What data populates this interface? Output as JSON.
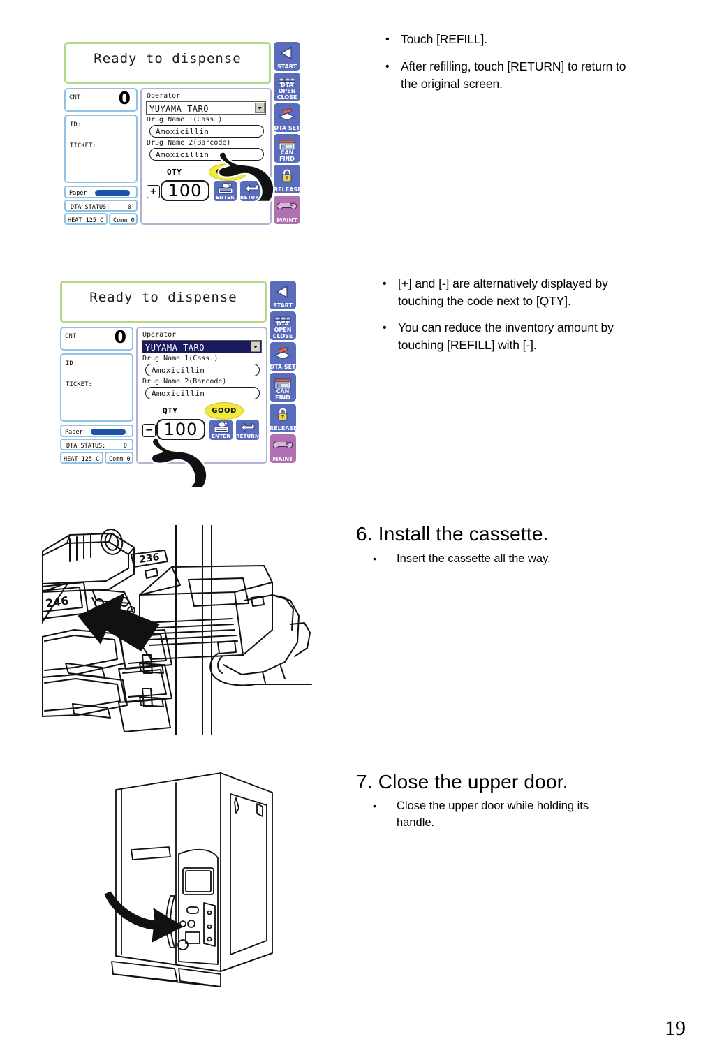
{
  "page": {
    "number": "19"
  },
  "screens": [
    {
      "id": "screen-refill-plus",
      "message": "Ready to dispense",
      "status": {
        "cnt_label": "CNT",
        "cnt_value": "0",
        "id_label": "ID:",
        "ticket_label": "TICKET:",
        "paper_label": "Paper",
        "dta_status_label": "DTA STATUS:",
        "dta_status_value": "0",
        "heat_label": "HEAT 125  C",
        "comm_label": "Comm 0"
      },
      "form": {
        "operator_label": "Operator",
        "operator_value": "YUYAMA TARO",
        "operator_selected": false,
        "drug1_label": "Drug Name 1(Cass.)",
        "drug1_value": "Amoxicillin",
        "drug2_label": "Drug Name 2(Barcode)",
        "drug2_value": "Amoxicillin",
        "qty_label": "QTY",
        "qty_value": "100",
        "sign_button": "+",
        "good_badge": "GOOD",
        "enter_label": "ENTER",
        "return_label": "RETURN"
      },
      "sidebar": [
        {
          "label": "START",
          "icon": "left-triangle-icon",
          "color": "#5a6dbd"
        },
        {
          "label": "DTA OPEN CLOSE",
          "icon": "dta-open-close-icon",
          "color": "#5a6dbd"
        },
        {
          "label": "DTA SET",
          "icon": "dta-set-icon",
          "color": "#5a6dbd"
        },
        {
          "label": "CAN FIND",
          "icon": "can-find-icon",
          "color": "#5a6dbd"
        },
        {
          "label": "RELEASE",
          "icon": "lock-icon",
          "color": "#5a6dbd"
        },
        {
          "label": "MAINT",
          "icon": "wrench-icon",
          "color": "#b071b3"
        }
      ]
    },
    {
      "id": "screen-refill-minus",
      "message": "Ready to dispense",
      "status": {
        "cnt_label": "CNT",
        "cnt_value": "0",
        "id_label": "ID:",
        "ticket_label": "TICKET:",
        "paper_label": "Paper",
        "dta_status_label": "DTA STATUS:",
        "dta_status_value": "0",
        "heat_label": "HEAT 125  C",
        "comm_label": "Comm 0"
      },
      "form": {
        "operator_label": "Operator",
        "operator_value": "YUYAMA TARO",
        "operator_selected": true,
        "drug1_label": "Drug Name 1(Cass.)",
        "drug1_value": "Amoxicillin",
        "drug2_label": "Drug Name 2(Barcode)",
        "drug2_value": "Amoxicillin",
        "qty_label": "QTY",
        "qty_value": "100",
        "sign_button": "−",
        "good_badge": "GOOD",
        "enter_label": "ENTER",
        "return_label": "RETURN"
      },
      "sidebar": [
        {
          "label": "START",
          "icon": "left-triangle-icon",
          "color": "#5a6dbd"
        },
        {
          "label": "DTA OPEN CLOSE",
          "icon": "dta-open-close-icon",
          "color": "#5a6dbd"
        },
        {
          "label": "DTA SET",
          "icon": "dta-set-icon",
          "color": "#5a6dbd"
        },
        {
          "label": "CAN FIND",
          "icon": "can-find-icon",
          "color": "#5a6dbd"
        },
        {
          "label": "RELEASE",
          "icon": "lock-icon",
          "color": "#5a6dbd"
        },
        {
          "label": "MAINT",
          "icon": "wrench-icon",
          "color": "#b071b3"
        }
      ]
    }
  ],
  "instructions": {
    "block1": [
      "Touch [REFILL].",
      "After refilling, touch [RETURN] to return to the original screen."
    ],
    "block2": [
      "[+] and [-] are alternatively displayed by touching the code next to [QTY].",
      "You can reduce the inventory amount by touching [REFILL] with [-]."
    ]
  },
  "steps": [
    {
      "number": "6",
      "separator": ".",
      "title": "Install the cassette.",
      "bullets": [
        "Insert the cassette all the way."
      ]
    },
    {
      "number": "7",
      "separator": ".",
      "title": "Close the upper door.",
      "bullets": [
        "Close the upper door while holding its handle."
      ]
    }
  ],
  "illustrations": {
    "cassette": {
      "name": "cassette-insertion-illustration",
      "labels": [
        "236",
        "246"
      ]
    },
    "door": {
      "name": "upper-door-close-illustration",
      "labels": []
    }
  },
  "bullet_glyph": "•"
}
